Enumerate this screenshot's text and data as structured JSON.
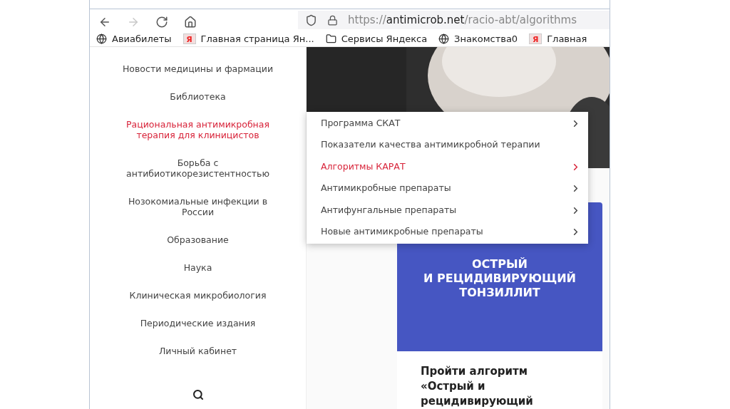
{
  "toolbar": {
    "buttons": [
      {
        "kind": "back",
        "disabled": false
      },
      {
        "kind": "forward",
        "disabled": true
      },
      {
        "kind": "reload",
        "disabled": false
      },
      {
        "kind": "home",
        "disabled": false
      }
    ],
    "url": {
      "scheme": "https://",
      "host": "antimicrob.net",
      "path": "/racio-abt/algorithms"
    }
  },
  "bookmarks": [
    {
      "kind": "globe",
      "label": "Авиабилеты"
    },
    {
      "kind": "yandex",
      "icon_text": "Я",
      "label": "Главная страница Ян..."
    },
    {
      "kind": "folder",
      "label": "Сервисы Яндекса"
    },
    {
      "kind": "globe",
      "label": "Знакомства0"
    },
    {
      "kind": "yandex",
      "icon_text": "Я",
      "label": "Главная"
    }
  ],
  "sidebar": {
    "items": [
      {
        "label": "Новости медицины и фармации",
        "selected": false
      },
      {
        "label": "Библиотека",
        "selected": false
      },
      {
        "label": "Рациональная антимикробная терапия для клиницистов",
        "selected": true
      },
      {
        "label": "Борьба с антибиотикорезистентностью",
        "selected": false
      },
      {
        "label": "Нозокомиальные инфекции в России",
        "selected": false
      },
      {
        "label": "Образование",
        "selected": false
      },
      {
        "label": "Наука",
        "selected": false
      },
      {
        "label": "Клиническая микробиология",
        "selected": false
      },
      {
        "label": "Периодические издания",
        "selected": false
      },
      {
        "label": "Личный кабинет",
        "selected": false
      }
    ]
  },
  "submenu": [
    {
      "label": "Программа СКАТ",
      "selected": false,
      "has_children": true
    },
    {
      "label": "Показатели качества антимикробной терапии",
      "selected": false,
      "has_children": false
    },
    {
      "label": "Алгоритмы КАРАТ",
      "selected": true,
      "has_children": true
    },
    {
      "label": "Антимикробные препараты",
      "selected": false,
      "has_children": true
    },
    {
      "label": "Антифунгальные препараты",
      "selected": false,
      "has_children": true
    },
    {
      "label": "Новые антимикробные препараты",
      "selected": false,
      "has_children": true
    }
  ],
  "card": {
    "title_lines": [
      "ОСТРЫЙ",
      "И РЕЦИДИВИРУЮЩИЙ",
      "ТОНЗИЛЛИТ"
    ],
    "link_text": "Пройти алгоритм «Острый и рецидивирующий"
  }
}
